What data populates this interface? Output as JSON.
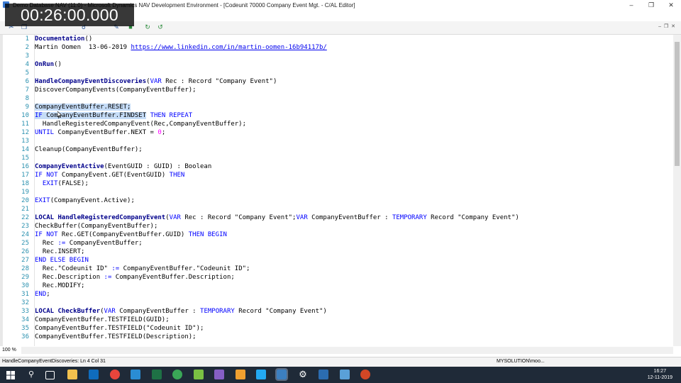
{
  "window": {
    "title": "Demo Database NAV (11.0) - Microsoft Dynamics NAV Development Environment - [Codeunit 70000 Company Event Mgt. - C/AL Editor]"
  },
  "overlay_timer": "00:26:00.000",
  "editor": {
    "lines": [
      {
        "n": "1",
        "segs": [
          {
            "t": "Documentation",
            "c": "fn"
          },
          {
            "t": "()"
          }
        ]
      },
      {
        "n": "2",
        "segs": [
          {
            "t": "Martin Oomen  13-06-2019 "
          },
          {
            "t": "https://www.linkedin.com/in/martin-oomen-16b94117b/",
            "c": "lnk"
          }
        ]
      },
      {
        "n": "3",
        "segs": []
      },
      {
        "n": "4",
        "segs": [
          {
            "t": "OnRun",
            "c": "fn"
          },
          {
            "t": "()"
          }
        ]
      },
      {
        "n": "5",
        "segs": []
      },
      {
        "n": "6",
        "segs": [
          {
            "t": "HandleCompanyEventDiscoveries",
            "c": "fn"
          },
          {
            "t": "("
          },
          {
            "t": "VAR",
            "c": "kw"
          },
          {
            "t": " Rec : Record \"Company Event\")"
          }
        ]
      },
      {
        "n": "7",
        "segs": [
          {
            "t": "DiscoverCompanyEvents(CompanyEventBuffer);"
          }
        ]
      },
      {
        "n": "8",
        "segs": []
      },
      {
        "n": "9",
        "segs": [
          {
            "t": "CompanyEventBuffer.RESET;",
            "c": "sel"
          }
        ]
      },
      {
        "n": "10",
        "segs": [
          {
            "t": "IF",
            "c": "kw sel"
          },
          {
            "t": " CompanyEventBuffer.FINDSET",
            "c": "sel"
          },
          {
            "t": " "
          },
          {
            "t": "THEN REPEAT",
            "c": "kw"
          }
        ]
      },
      {
        "n": "11",
        "segs": [
          {
            "t": "  HandleRegisteredCompanyEvent(Rec,CompanyEventBuffer);"
          }
        ]
      },
      {
        "n": "12",
        "segs": [
          {
            "t": "UNTIL",
            "c": "kw"
          },
          {
            "t": " CompanyEventBuffer.NEXT = "
          },
          {
            "t": "0",
            "c": "num"
          },
          {
            "t": ";"
          }
        ]
      },
      {
        "n": "13",
        "segs": []
      },
      {
        "n": "14",
        "segs": [
          {
            "t": "Cleanup(CompanyEventBuffer);"
          }
        ]
      },
      {
        "n": "15",
        "segs": []
      },
      {
        "n": "16",
        "segs": [
          {
            "t": "CompanyEventActive",
            "c": "fn"
          },
          {
            "t": "(EventGUID : GUID) : Boolean"
          }
        ]
      },
      {
        "n": "17",
        "segs": [
          {
            "t": "IF NOT",
            "c": "kw"
          },
          {
            "t": " CompanyEvent.GET(EventGUID) "
          },
          {
            "t": "THEN",
            "c": "kw"
          }
        ]
      },
      {
        "n": "18",
        "segs": [
          {
            "t": "  "
          },
          {
            "t": "EXIT",
            "c": "kw"
          },
          {
            "t": "(FALSE);"
          }
        ]
      },
      {
        "n": "19",
        "segs": []
      },
      {
        "n": "20",
        "segs": [
          {
            "t": "EXIT",
            "c": "kw"
          },
          {
            "t": "(CompanyEvent.Active);"
          }
        ]
      },
      {
        "n": "21",
        "segs": []
      },
      {
        "n": "22",
        "segs": [
          {
            "t": "LOCAL HandleRegisteredCompanyEvent",
            "c": "fn"
          },
          {
            "t": "("
          },
          {
            "t": "VAR",
            "c": "kw"
          },
          {
            "t": " Rec : Record \"Company Event\";"
          },
          {
            "t": "VAR",
            "c": "kw"
          },
          {
            "t": " CompanyEventBuffer : "
          },
          {
            "t": "TEMPORARY",
            "c": "kw"
          },
          {
            "t": " Record \"Company Event\")"
          }
        ]
      },
      {
        "n": "23",
        "segs": [
          {
            "t": "CheckBuffer(CompanyEventBuffer);"
          }
        ]
      },
      {
        "n": "24",
        "segs": [
          {
            "t": "IF NOT",
            "c": "kw"
          },
          {
            "t": " Rec.GET(CompanyEventBuffer.GUID) "
          },
          {
            "t": "THEN BEGIN",
            "c": "kw"
          }
        ]
      },
      {
        "n": "25",
        "segs": [
          {
            "t": "  Rec "
          },
          {
            "t": ":=",
            "c": "kw"
          },
          {
            "t": " CompanyEventBuffer;"
          }
        ]
      },
      {
        "n": "26",
        "segs": [
          {
            "t": "  Rec.INSERT;"
          }
        ]
      },
      {
        "n": "27",
        "segs": [
          {
            "t": "END ELSE BEGIN",
            "c": "kw"
          }
        ]
      },
      {
        "n": "28",
        "segs": [
          {
            "t": "  Rec.\"Codeunit ID\" "
          },
          {
            "t": ":=",
            "c": "kw"
          },
          {
            "t": " CompanyEventBuffer.\"Codeunit ID\";"
          }
        ]
      },
      {
        "n": "29",
        "segs": [
          {
            "t": "  Rec.Description "
          },
          {
            "t": ":=",
            "c": "kw"
          },
          {
            "t": " CompanyEventBuffer.Description;"
          }
        ]
      },
      {
        "n": "30",
        "segs": [
          {
            "t": "  Rec.MODIFY;"
          }
        ]
      },
      {
        "n": "31",
        "segs": [
          {
            "t": "END",
            "c": "kw"
          },
          {
            "t": ";"
          }
        ]
      },
      {
        "n": "32",
        "segs": []
      },
      {
        "n": "33",
        "segs": [
          {
            "t": "LOCAL CheckBuffer",
            "c": "fn"
          },
          {
            "t": "("
          },
          {
            "t": "VAR",
            "c": "kw"
          },
          {
            "t": " CompanyEventBuffer : "
          },
          {
            "t": "TEMPORARY",
            "c": "kw"
          },
          {
            "t": " Record \"Company Event\")"
          }
        ]
      },
      {
        "n": "34",
        "segs": [
          {
            "t": "CompanyEventBuffer.TESTFIELD(GUID);"
          }
        ]
      },
      {
        "n": "35",
        "segs": [
          {
            "t": "CompanyEventBuffer.TESTFIELD(\"Codeunit ID\");"
          }
        ]
      },
      {
        "n": "36",
        "segs": [
          {
            "t": "CompanyEventBuffer.TESTFIELD(Description);"
          }
        ]
      }
    ]
  },
  "zoom": "100 %",
  "status": {
    "left": "HandleCompanyEventDiscoveries: Ln 4 Col 31",
    "right": "MYSOLUTION\\moo..."
  },
  "taskbar": {
    "time": "16:27",
    "date": "12-11-2019"
  },
  "colors": {
    "keyword": "#0000ff",
    "line_number": "#2b91af",
    "selection": "#c5dcf7",
    "taskbar": "#1f2a38"
  }
}
